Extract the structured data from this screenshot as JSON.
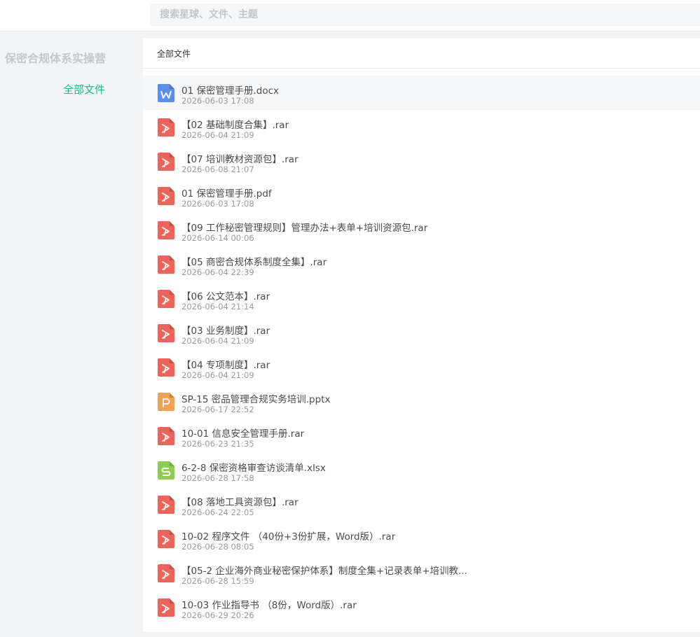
{
  "search": {
    "placeholder": "搜索星球、文件、主题"
  },
  "sidebar": {
    "group_name": "保密合规体系实操营",
    "all_files": "全部文件"
  },
  "panel": {
    "header": "全部文件"
  },
  "colors": {
    "accent": "#16b998",
    "pdf": "#f16358",
    "doc": "#5b8def",
    "ppt": "#f3a14e",
    "xls": "#8ccf4f"
  },
  "files": [
    {
      "name": "01 保密管理手册.docx",
      "date": "2026-06-03 17:08",
      "type": "word-file-icon"
    },
    {
      "name": "【02 基础制度合集】.rar",
      "date": "2026-06-04 21:09",
      "type": "pdf-file-icon"
    },
    {
      "name": "【07 培训教材资源包】.rar",
      "date": "2026-06-08 21:07",
      "type": "pdf-file-icon"
    },
    {
      "name": "01 保密管理手册.pdf",
      "date": "2026-06-03 17:08",
      "type": "pdf-file-icon"
    },
    {
      "name": "【09 工作秘密管理规则】管理办法+表单+培训资源包.rar",
      "date": "2026-06-14 00:06",
      "type": "pdf-file-icon"
    },
    {
      "name": "【05 商密合规体系制度全集】.rar",
      "date": "2026-06-04 22:39",
      "type": "pdf-file-icon"
    },
    {
      "name": "【06 公文范本】.rar",
      "date": "2026-06-04 21:14",
      "type": "pdf-file-icon"
    },
    {
      "name": "【03 业务制度】.rar",
      "date": "2026-06-04 21:09",
      "type": "pdf-file-icon"
    },
    {
      "name": "【04 专项制度】.rar",
      "date": "2026-06-04 21:09",
      "type": "pdf-file-icon"
    },
    {
      "name": "SP-15 密品管理合规实务培训.pptx",
      "date": "2026-06-17 22:52",
      "type": "ppt-file-icon"
    },
    {
      "name": "10-01 信息安全管理手册.rar",
      "date": "2026-06-23 21:35",
      "type": "pdf-file-icon"
    },
    {
      "name": "6-2-8 保密资格审查访谈清单.xlsx",
      "date": "2026-06-28 17:58",
      "type": "excel-file-icon"
    },
    {
      "name": "【08 落地工具资源包】.rar",
      "date": "2026-06-24 22:05",
      "type": "pdf-file-icon"
    },
    {
      "name": "10-02 程序文件 （40份+3份扩展，Word版）.rar",
      "date": "2026-06-28 08:05",
      "type": "pdf-file-icon"
    },
    {
      "name": "【05-2 企业海外商业秘密保护体系】制度全集+记录表单+培训教...",
      "date": "2026-06-28 15:59",
      "type": "pdf-file-icon"
    },
    {
      "name": "10-03 作业指导书 （8份，Word版）.rar",
      "date": "2026-06-29 20:26",
      "type": "pdf-file-icon"
    }
  ]
}
